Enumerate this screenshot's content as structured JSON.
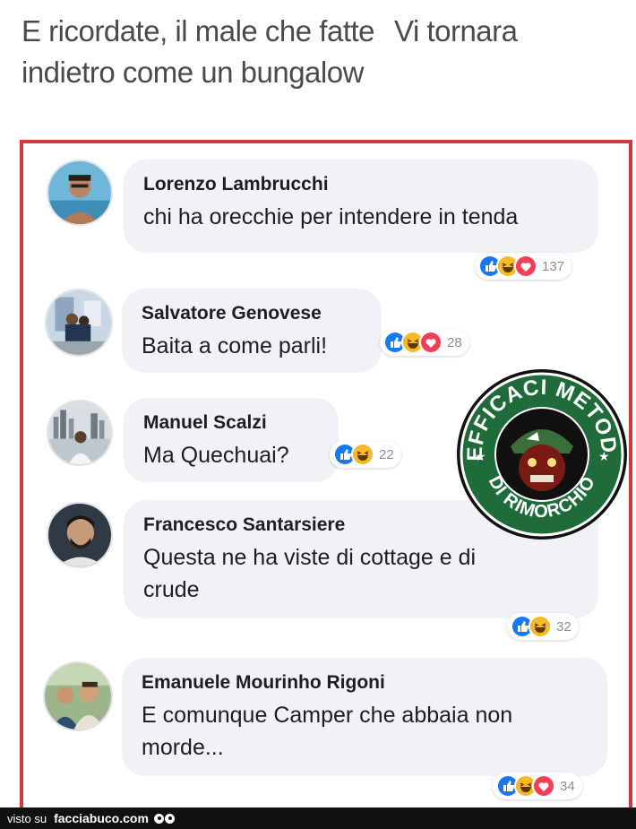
{
  "caption": {
    "line1_part1": "E ricordate, il male che fatte",
    "line1_part2": "Vi tornara",
    "line2": "indietro come un bungalow"
  },
  "colors": {
    "frame": "#d23a3e",
    "bubble": "#f0f2f5",
    "like": "#1877f2",
    "haha": "#f7b928",
    "love": "#f33e58",
    "badge_green": "#1f6b3a"
  },
  "comments": [
    {
      "name": "Lorenzo Lambrucchi",
      "text": "chi ha orecchie per intendere in tenda",
      "reactions": [
        "like-icon",
        "haha-icon",
        "love-icon"
      ],
      "count": "137"
    },
    {
      "name": "Salvatore Genovese",
      "text": "Baita a come parli!",
      "reactions": [
        "like-icon",
        "haha-icon",
        "love-icon"
      ],
      "count": "28"
    },
    {
      "name": "Manuel Scalzi",
      "text": "Ma Quechuai?",
      "reactions": [
        "like-icon",
        "haha-icon"
      ],
      "count": "22"
    },
    {
      "name": "Francesco Santarsiere",
      "text_line1": "Questa ne ha viste di cottage e di",
      "text_line2": "crude",
      "reactions": [
        "like-icon",
        "haha-icon"
      ],
      "count": "32"
    },
    {
      "name": "Emanuele Mourinho Rigoni",
      "text_line1": "E comunque Camper che abbaia non",
      "text_line2": "morde...",
      "reactions": [
        "like-icon",
        "haha-icon",
        "love-icon"
      ],
      "count": "34"
    }
  ],
  "badge": {
    "top_text": "EFFICACI METODI",
    "bottom_text": "DI RIMORCHIO"
  },
  "footer": {
    "prefix": "visto su",
    "brand": "facciabuco.com"
  }
}
